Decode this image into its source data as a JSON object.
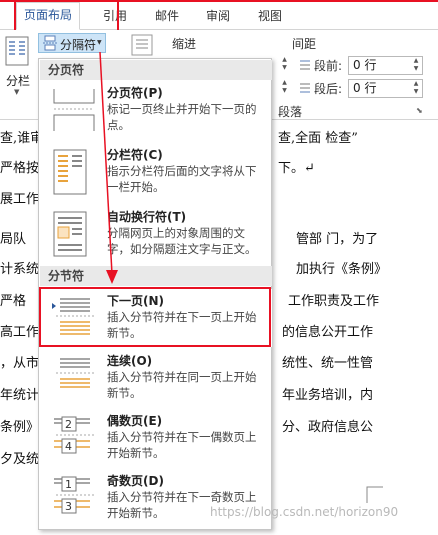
{
  "tabs": [
    "页面布局",
    "引用",
    "邮件",
    "审阅",
    "视图"
  ],
  "ribbon": {
    "columns_label": "分栏",
    "breaks_label": "分隔符",
    "indent_label": "缩进",
    "spacing_label": "间距",
    "before_label": "段前:",
    "after_label": "段后:",
    "before_value": "0 行",
    "after_value": "0 行",
    "group_label": "段落"
  },
  "menu": {
    "section_page": "分页符",
    "section_section": "分节符",
    "items": [
      {
        "title": "分页符(P)",
        "desc": "标记一页终止并开始下一页的点。"
      },
      {
        "title": "分栏符(C)",
        "desc": "指示分栏符后面的文字将从下一栏开始。"
      },
      {
        "title": "自动换行符(T)",
        "desc": "分隔网页上的对象周围的文字，如分隔题注文字与正文。"
      },
      {
        "title": "下一页(N)",
        "desc": "插入分节符并在下一页上开始新节。"
      },
      {
        "title": "连续(O)",
        "desc": "插入分节符并在同一页上开始新节。"
      },
      {
        "title": "偶数页(E)",
        "desc": "插入分节符并在下一偶数页上开始新节。"
      },
      {
        "title": "奇数页(D)",
        "desc": "插入分节符并在下一奇数页上开始新节。"
      }
    ]
  },
  "doc": {
    "lines_left": [
      "查,谁审",
      "严格按",
      "展工作",
      "局队 ",
      "计系统",
      "  严格",
      "高工作",
      "，从市",
      "年统计",
      "条例》",
      "夕及统"
    ],
    "lines_right": [
      "查,全面 检查”",
      "下。↵",
      "",
      "管部 门，为了",
      "加执行《条例》",
      "工作职责及工作",
      "的信息公开工作",
      "统性、统一性管",
      "年业务培训，内",
      "分、政府信息公",
      ""
    ]
  },
  "watermark": "https://blog.csdn.net/horizon90",
  "colors": {
    "highlight": "#e81123",
    "accent": "#2b579a"
  }
}
